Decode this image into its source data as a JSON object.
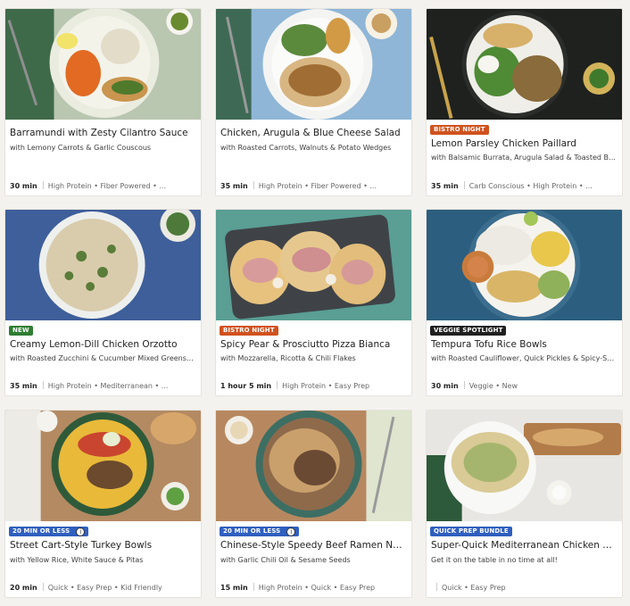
{
  "colors": {
    "badge_bistro": "#d0521e",
    "badge_new": "#2e7d32",
    "badge_veggie": "#1f1f1f",
    "badge_20min": "#2f5fbf",
    "badge_quickprep": "#2f5fbf"
  },
  "recipes": [
    {
      "title": "Barramundi with Zesty Cilantro Sauce",
      "subtitle": "with Lemony Carrots & Garlic Couscous",
      "time": "30 min",
      "tags": "High Protein • Fiber Powered • ...",
      "badge": ""
    },
    {
      "title": "Chicken, Arugula & Blue Cheese Salad",
      "subtitle": "with Roasted Carrots, Walnuts & Potato Wedges",
      "time": "35 min",
      "tags": "High Protein • Fiber Powered • ...",
      "badge": ""
    },
    {
      "title": "Lemon Parsley Chicken Paillard",
      "subtitle": "with Balsamic Burrata, Arugula Salad & Toasted Bag...",
      "time": "35 min",
      "tags": "Carb Conscious • High Protein • ...",
      "badge": "BISTRO NIGHT"
    },
    {
      "title": "Creamy Lemon-Dill Chicken Orzotto",
      "subtitle": "with Roasted Zucchini & Cucumber Mixed Greens Sa...",
      "time": "35 min",
      "tags": "High Protein • Mediterranean • ...",
      "badge": "NEW"
    },
    {
      "title": "Spicy Pear & Prosciutto Pizza Bianca",
      "subtitle": "with Mozzarella, Ricotta & Chili Flakes",
      "time": "1 hour 5 min",
      "tags": "High Protein • Easy Prep",
      "badge": "BISTRO NIGHT"
    },
    {
      "title": "Tempura Tofu Rice Bowls",
      "subtitle": "with Roasted Cauliflower, Quick Pickles & Spicy-Swe...",
      "time": "30 min",
      "tags": "Veggie • New",
      "badge": "VEGGIE SPOTLIGHT"
    },
    {
      "title": "Street Cart-Style Turkey Bowls",
      "subtitle": "with Yellow Rice, White Sauce & Pitas",
      "time": "20 min",
      "tags": "Quick • Easy Prep • Kid Friendly",
      "badge": "20 MIN OR LESS"
    },
    {
      "title": "Chinese-Style Speedy Beef Ramen Noo...",
      "subtitle": "with Garlic Chili Oil & Sesame Seeds",
      "time": "15 min",
      "tags": "High Protein • Quick • Easy Prep",
      "badge": "20 MIN OR LESS"
    },
    {
      "title": "Super-Quick Mediterranean Chicken Sal...",
      "subtitle": "Get it on the table in no time at all!",
      "time": "",
      "tags": "Quick • Easy Prep",
      "badge": "QUICK PREP BUNDLE"
    }
  ]
}
